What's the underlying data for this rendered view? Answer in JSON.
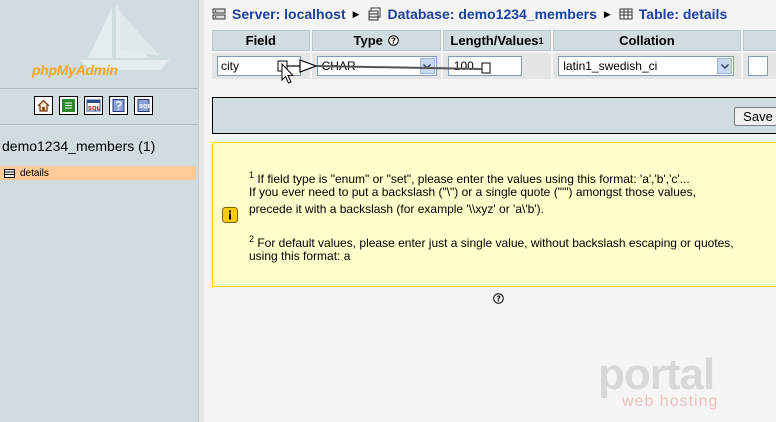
{
  "nav": {
    "logo_php": "php",
    "logo_myadmin": "MyAdmin",
    "database": "demo1234_members (1)",
    "tables": [
      {
        "label": "details"
      }
    ]
  },
  "breadcrumb": {
    "server": "Server: localhost",
    "database": "Database: demo1234_members",
    "table": "Table: details"
  },
  "table": {
    "headers": {
      "field": "Field",
      "type": "Type",
      "length": "Length/Values",
      "length_sup": "1",
      "collation": "Collation"
    },
    "row": {
      "field": "city",
      "type": "CHAR",
      "length": "100",
      "collation": "latin1_swedish_ci"
    }
  },
  "save_label": "Save",
  "notice": {
    "n1_sup": "1",
    "n1_line1": " If field type is \"enum\" or \"set\", please enter the values using this format: 'a','b','c'...",
    "n1_line2": "If you ever need to put a backslash (\"\\\") or a single quote (\"'\") amongst those values,",
    "n1_line3": "precede it with a backslash (for example '\\\\xyz' or 'a\\'b').",
    "n2_sup": "2",
    "n2_line1": " For default values, please enter just a single value, without backslash escaping or quotes,",
    "n2_line2": "using this format: a"
  },
  "watermark": {
    "brand": "portal",
    "sub": "web hosting"
  },
  "colors": {
    "nav_bg": "#d0dce0",
    "link": "#2040a0",
    "notice_bg": "#ffffcc",
    "selected_row": "#ffcc99"
  }
}
